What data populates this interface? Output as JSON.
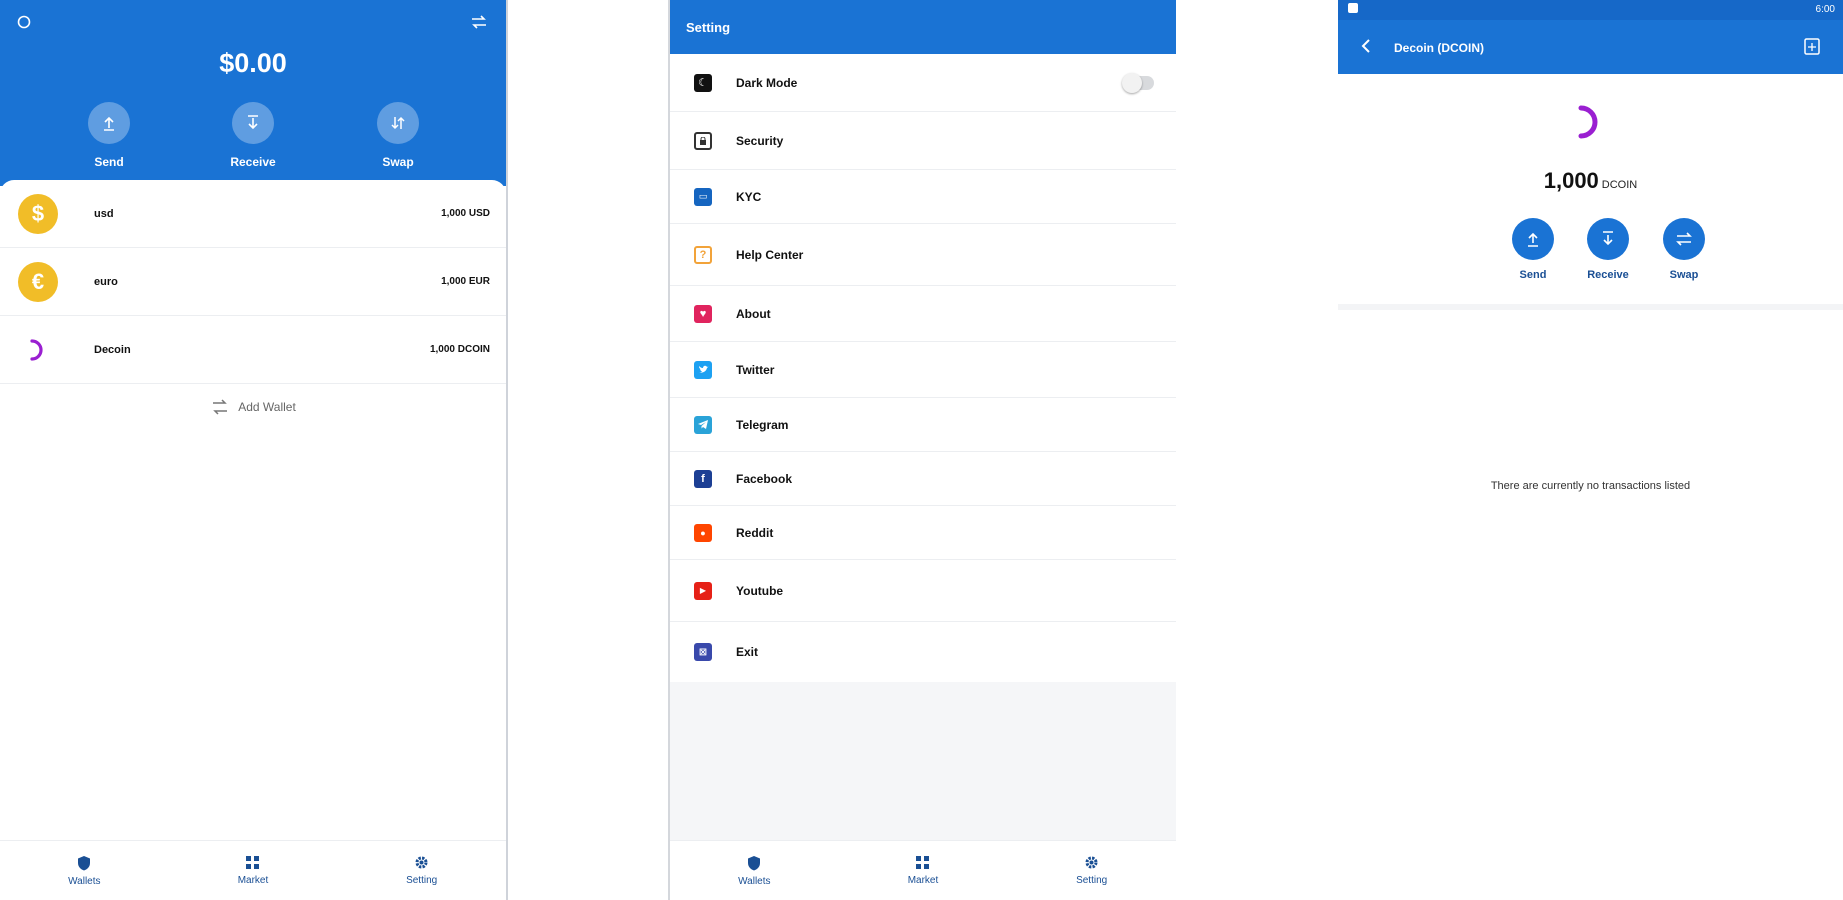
{
  "wallets_screen": {
    "balance": "$0.00",
    "actions": [
      {
        "label": "Send"
      },
      {
        "label": "Receive"
      },
      {
        "label": "Swap"
      }
    ],
    "wallets": [
      {
        "name": "usd",
        "amount": "1,000 USD",
        "icon": "dollar-coin-icon",
        "symbol": "$"
      },
      {
        "name": "euro",
        "amount": "1,000 EUR",
        "icon": "euro-coin-icon",
        "symbol": "€"
      },
      {
        "name": "Decoin",
        "amount": "1,000 DCOIN",
        "icon": "decoin-logo-icon"
      }
    ],
    "add_wallet_label": "Add Wallet",
    "nav": [
      {
        "label": "Wallets",
        "icon": "shield-icon"
      },
      {
        "label": "Market",
        "icon": "grid-icon"
      },
      {
        "label": "Setting",
        "icon": "gear-icon"
      }
    ],
    "colors": {
      "header": "#1a73d4",
      "coin": "#f1bd28",
      "decoin": "#9a1fd1"
    }
  },
  "setting_screen": {
    "title": "Setting",
    "items": [
      {
        "label": "Dark Mode",
        "icon": "moon-icon",
        "color": "#111111"
      },
      {
        "label": "Security",
        "icon": "lock-icon",
        "color": "#333333"
      },
      {
        "label": "KYC",
        "icon": "id-card-icon",
        "color": "#1565c0"
      },
      {
        "label": "Help Center",
        "icon": "help-icon",
        "color": "#f2a33a"
      },
      {
        "label": "About",
        "icon": "heart-icon",
        "color": "#e0245e"
      },
      {
        "label": "Twitter",
        "icon": "twitter-icon",
        "color": "#1da1f2"
      },
      {
        "label": "Telegram",
        "icon": "telegram-icon",
        "color": "#2aa3d8"
      },
      {
        "label": "Facebook",
        "icon": "facebook-icon",
        "color": "#1c3f94"
      },
      {
        "label": "Reddit",
        "icon": "reddit-icon",
        "color": "#ff4500"
      },
      {
        "label": "Youtube",
        "icon": "youtube-icon",
        "color": "#e62117"
      },
      {
        "label": "Exit",
        "icon": "exit-icon",
        "color": "#3949ab"
      }
    ],
    "dark_mode_enabled": false,
    "nav": [
      {
        "label": "Wallets",
        "icon": "shield-icon"
      },
      {
        "label": "Market",
        "icon": "grid-icon"
      },
      {
        "label": "Setting",
        "icon": "gear-icon"
      }
    ]
  },
  "coin_screen": {
    "status_time": "6:00",
    "title": "Decoin (DCOIN)",
    "amount": "1,000",
    "unit": "DCOIN",
    "actions": [
      {
        "label": "Send"
      },
      {
        "label": "Receive"
      },
      {
        "label": "Swap"
      }
    ],
    "empty_message": "There are currently no transactions listed"
  }
}
